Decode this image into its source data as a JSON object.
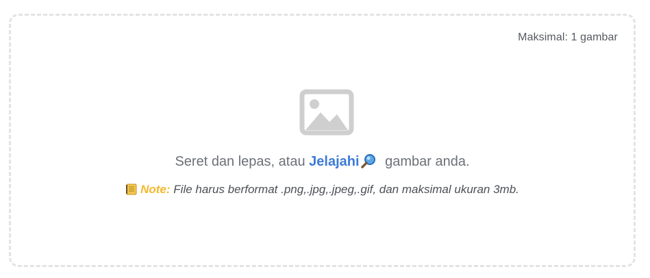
{
  "dropzone": {
    "limit_text": "Maksimal: 1 gambar",
    "instruction_before": "Seret dan lepas, atau ",
    "browse_label": "Jelajahi",
    "instruction_after": " gambar anda.",
    "note_label": "Note:",
    "note_text": " File harus berformat .png,.jpg,.jpeg,.gif, dan maksimal ukuran 3mb.",
    "icons": {
      "placeholder": "image-placeholder-icon",
      "browse": "magnifier-icon",
      "note": "notebook-icon"
    },
    "colors": {
      "border": "#e3e3e3",
      "link": "#3d7bd6",
      "note_label": "#f5b82e",
      "placeholder_icon": "#cfcfcf",
      "text": "#6b7076"
    }
  }
}
